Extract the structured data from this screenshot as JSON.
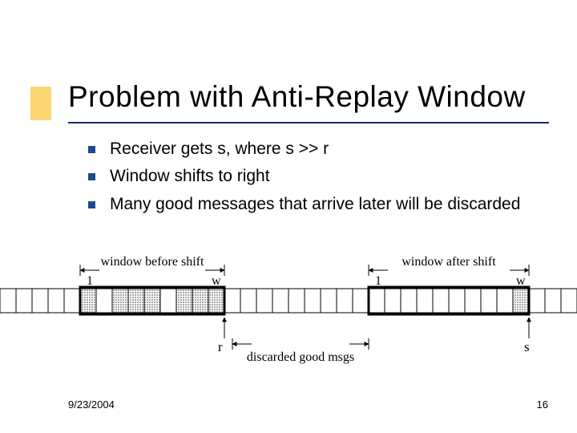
{
  "title": "Problem with Anti-Replay Window",
  "bullets": [
    "Receiver gets s, where s >> r",
    "Window shifts to right",
    "Many good messages that arrive later will be discarded"
  ],
  "labels": {
    "before": "window before shift",
    "after": "window after shift",
    "one_left": "1",
    "w_left": "w",
    "one_right": "1",
    "w_right": "w",
    "r": "r",
    "s": "s",
    "discarded": "discarded good msgs"
  },
  "footer": {
    "date": "9/23/2004",
    "page": "16"
  }
}
